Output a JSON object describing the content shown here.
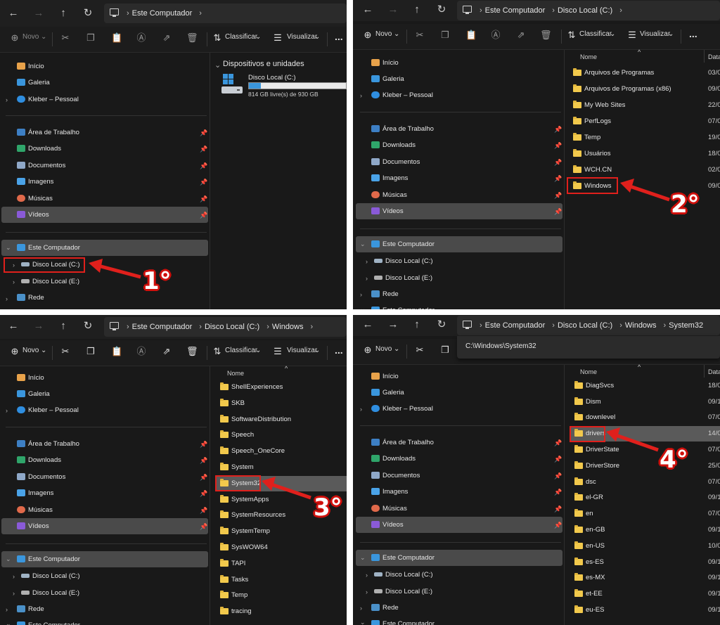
{
  "toolbar": {
    "new_label": "Novo",
    "sort_label": "Classificar",
    "view_label": "Visualizar",
    "more_label": "..."
  },
  "sidebar": {
    "home": "Início",
    "gallery": "Galeria",
    "onedrive": "Kleber – Pessoal",
    "desktop": "Área de Trabalho",
    "downloads": "Downloads",
    "documents": "Documentos",
    "images": "Imagens",
    "music": "Músicas",
    "videos": "Vídeos",
    "this_pc": "Este Computador",
    "disk_c": "Disco Local (C:)",
    "disk_e": "Disco Local (E:)",
    "network": "Rede"
  },
  "panel1": {
    "breadcrumb": [
      "Este Computador"
    ],
    "section_title": "Dispositivos e unidades",
    "drive_name": "Disco Local (C:)",
    "drive_free": "814 GB livre(s) de 930 GB",
    "drive_used_fraction": 0.125,
    "step": "1°"
  },
  "panel2": {
    "breadcrumb": [
      "Este Computador",
      "Disco Local (C:)"
    ],
    "col_name": "Nome",
    "col_date": "Data",
    "rows": [
      {
        "name": "Arquivos de Programas",
        "date": "03/0"
      },
      {
        "name": "Arquivos de Programas (x86)",
        "date": "09/0"
      },
      {
        "name": "My Web Sites",
        "date": "22/0"
      },
      {
        "name": "PerfLogs",
        "date": "07/0"
      },
      {
        "name": "Temp",
        "date": "19/0"
      },
      {
        "name": "Usuários",
        "date": "18/0"
      },
      {
        "name": "WCH.CN",
        "date": "02/0"
      },
      {
        "name": "Windows",
        "date": "09/0"
      }
    ],
    "step": "2°"
  },
  "panel3": {
    "breadcrumb": [
      "Este Computador",
      "Disco Local (C:)",
      "Windows"
    ],
    "col_name": "Nome",
    "rows": [
      {
        "name": "ShellExperiences"
      },
      {
        "name": "SKB"
      },
      {
        "name": "SoftwareDistribution"
      },
      {
        "name": "Speech"
      },
      {
        "name": "Speech_OneCore"
      },
      {
        "name": "System"
      },
      {
        "name": "System32"
      },
      {
        "name": "SystemApps"
      },
      {
        "name": "SystemResources"
      },
      {
        "name": "SystemTemp"
      },
      {
        "name": "SysWOW64"
      },
      {
        "name": "TAPI"
      },
      {
        "name": "Tasks"
      },
      {
        "name": "Temp"
      },
      {
        "name": "tracing"
      }
    ],
    "step": "3°"
  },
  "panel4": {
    "breadcrumb": [
      "Este Computador",
      "Disco Local (C:)",
      "Windows",
      "System32"
    ],
    "path_value": "C:\\Windows\\System32",
    "col_name": "Nome",
    "col_date": "Data",
    "rows": [
      {
        "name": "DiagSvcs",
        "date": "18/0"
      },
      {
        "name": "Dism",
        "date": "09/1"
      },
      {
        "name": "downlevel",
        "date": "07/0"
      },
      {
        "name": "drivers",
        "date": "14/0"
      },
      {
        "name": "DriverState",
        "date": "07/0"
      },
      {
        "name": "DriverStore",
        "date": "25/0"
      },
      {
        "name": "dsc",
        "date": "07/0"
      },
      {
        "name": "el-GR",
        "date": "09/1"
      },
      {
        "name": "en",
        "date": "07/0"
      },
      {
        "name": "en-GB",
        "date": "09/1"
      },
      {
        "name": "en-US",
        "date": "10/0"
      },
      {
        "name": "es-ES",
        "date": "09/1"
      },
      {
        "name": "es-MX",
        "date": "09/1"
      },
      {
        "name": "et-EE",
        "date": "09/1"
      },
      {
        "name": "eu-ES",
        "date": "09/1"
      }
    ],
    "step": "4°"
  },
  "colors": {
    "panel_bg": "#191919",
    "selection": "#4a4a4a",
    "folder": "#f2c94c",
    "annotation_red": "#e0201c",
    "drive_bar": "#3a96dd"
  }
}
